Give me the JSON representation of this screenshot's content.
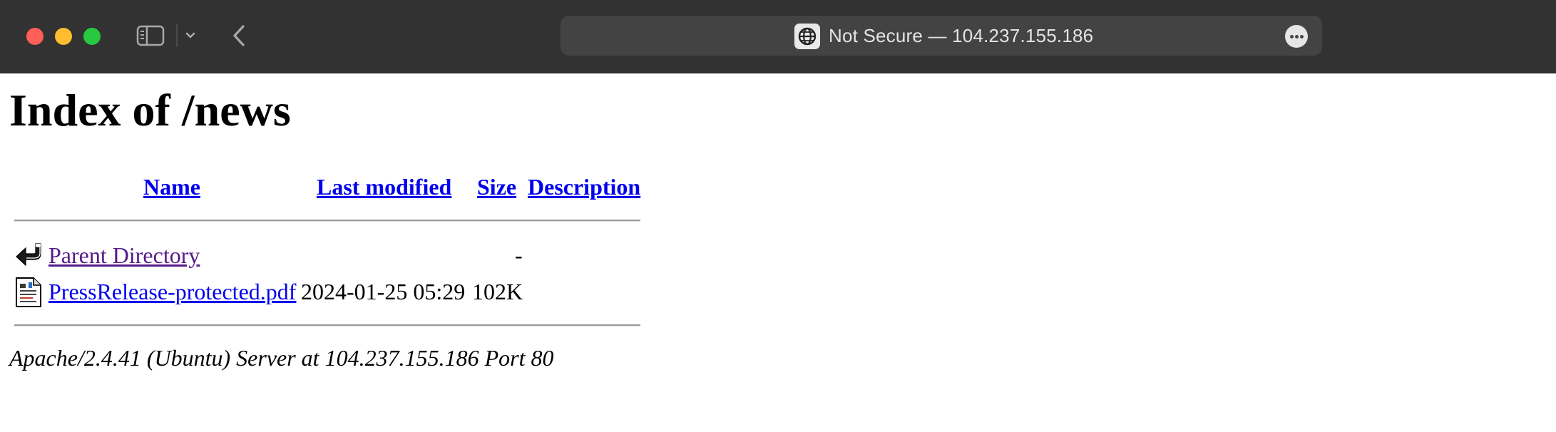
{
  "browser": {
    "url_display": "Not Secure — 104.237.155.186"
  },
  "page": {
    "title": "Index of /news",
    "columns": {
      "name": "Name",
      "last_modified": "Last modified",
      "size": "Size",
      "description": "Description"
    },
    "rows": [
      {
        "name": "Parent Directory",
        "last_modified": "",
        "size": "-",
        "description": "",
        "icon": "back-arrow-icon"
      },
      {
        "name": "PressRelease-protected.pdf",
        "last_modified": "2024-01-25 05:29",
        "size": "102K",
        "description": "",
        "icon": "document-icon"
      }
    ],
    "footer": "Apache/2.4.41 (Ubuntu) Server at 104.237.155.186 Port 80"
  }
}
